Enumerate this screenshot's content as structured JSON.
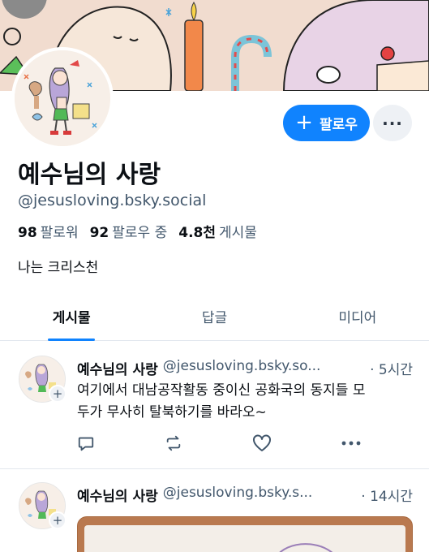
{
  "profile": {
    "display_name": "예수님의 사랑",
    "handle": "@jesusloving.bsky.social",
    "stats": {
      "followers_count": "98",
      "followers_label": "팔로워",
      "following_count": "92",
      "following_label": "팔로우 중",
      "posts_count": "4.8천",
      "posts_label": "게시물"
    },
    "bio": "나는 크리스천",
    "follow_label": "팔로우",
    "more_label": "···"
  },
  "tabs": [
    {
      "label": "게시물",
      "active": true
    },
    {
      "label": "답글",
      "active": false
    },
    {
      "label": "미디어",
      "active": false
    }
  ],
  "posts": [
    {
      "author": "예수님의 사랑",
      "handle": "@jesusloving.bsky.so...",
      "time": "· 5시간",
      "text_line1": "여기에서 대남공작활동 중이신 공화국의 동지들 모",
      "text_line2": "두가 무사히 탈북하기를 바라오~"
    },
    {
      "author": "예수님의 사랑",
      "handle": "@jesusloving.bsky.s...",
      "time": "· 14시간"
    }
  ],
  "icons": {
    "follow": "plus-icon",
    "more": "ellipsis-icon",
    "reply": "speech-bubble-icon",
    "repost": "repost-arrows-icon",
    "like": "heart-icon",
    "post_more": "ellipsis-icon"
  },
  "colors": {
    "accent": "#1083fe",
    "text_primary": "#0b0f14",
    "text_secondary": "#42576c",
    "divider": "#e2e7ee"
  }
}
